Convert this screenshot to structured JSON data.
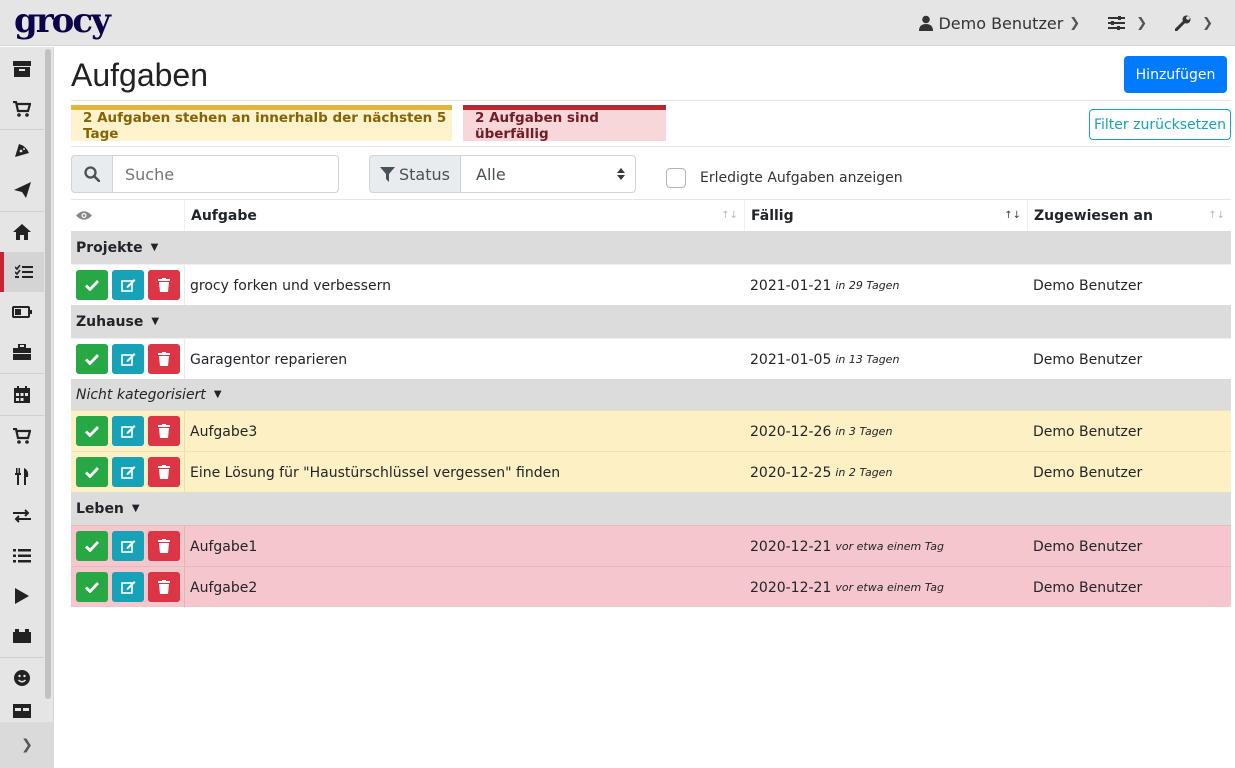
{
  "app": {
    "logo": "grocy"
  },
  "topnav": {
    "user": "Demo Benutzer"
  },
  "page": {
    "title": "Aufgaben",
    "add_label": "Hinzufügen",
    "reset_filter_label": "Filter zurücksetzen"
  },
  "alerts": {
    "due_soon": "2 Aufgaben stehen an innerhalb der nächsten 5 Tage",
    "overdue": "2 Aufgaben sind überfällig"
  },
  "filters": {
    "search_placeholder": "Suche",
    "status_label": "Status",
    "status_value": "Alle",
    "show_done_label": "Erledigte Aufgaben anzeigen"
  },
  "table": {
    "headers": {
      "task": "Aufgabe",
      "due": "Fällig",
      "assigned": "Zugewiesen an"
    },
    "groups": [
      {
        "name": "Projekte",
        "rows": [
          {
            "task": "grocy forken und verbessern",
            "due": "2021-01-21",
            "due_rel": "in 29 Tagen",
            "assigned": "Demo Benutzer",
            "status": "normal"
          }
        ]
      },
      {
        "name": "Zuhause",
        "rows": [
          {
            "task": "Garagentor reparieren",
            "due": "2021-01-05",
            "due_rel": "in 13 Tagen",
            "assigned": "Demo Benutzer",
            "status": "normal"
          }
        ]
      },
      {
        "name": "Nicht kategorisiert",
        "rows": [
          {
            "task": "Aufgabe3",
            "due": "2020-12-26",
            "due_rel": "in 3 Tagen",
            "assigned": "Demo Benutzer",
            "status": "due-soon"
          },
          {
            "task": "Eine Lösung für \"Haustürschlüssel vergessen\" finden",
            "due": "2020-12-25",
            "due_rel": "in 2 Tagen",
            "assigned": "Demo Benutzer",
            "status": "due-soon"
          }
        ]
      },
      {
        "name": "Leben",
        "rows": [
          {
            "task": "Aufgabe1",
            "due": "2020-12-21",
            "due_rel": "vor etwa einem Tag",
            "assigned": "Demo Benutzer",
            "status": "overdue"
          },
          {
            "task": "Aufgabe2",
            "due": "2020-12-21",
            "due_rel": "vor etwa einem Tag",
            "assigned": "Demo Benutzer",
            "status": "overdue"
          }
        ]
      }
    ]
  },
  "colors": {
    "primary": "#007bff",
    "success": "#28a745",
    "info": "#17a2b8",
    "danger": "#dc3545",
    "warning_bg": "#fdf0c4",
    "danger_bg": "#f5c6cb"
  },
  "sidebar_icons": [
    "box-icon",
    "cart-icon",
    "pizza-icon",
    "send-icon",
    "home-icon",
    "tasks-icon",
    "battery-icon",
    "toolbox-icon",
    "calendar-icon",
    "cart-plus-icon",
    "utensils-icon",
    "exchange-icon",
    "list-icon",
    "play-icon",
    "car-icon",
    "smile-icon",
    "table-icon"
  ]
}
